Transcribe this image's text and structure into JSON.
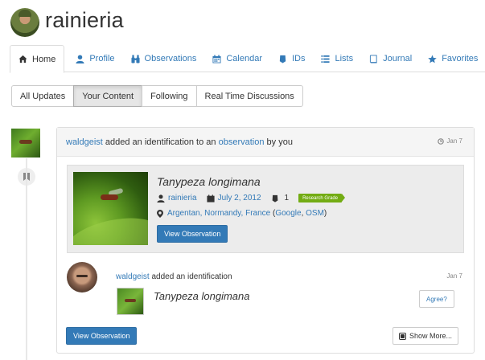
{
  "profile": {
    "username": "rainieria"
  },
  "tabs": [
    {
      "label": "Home",
      "icon": "home-icon"
    },
    {
      "label": "Profile",
      "icon": "user-icon"
    },
    {
      "label": "Observations",
      "icon": "binoculars-icon"
    },
    {
      "label": "Calendar",
      "icon": "calendar-icon"
    },
    {
      "label": "IDs",
      "icon": "tag-icon"
    },
    {
      "label": "Lists",
      "icon": "list-icon"
    },
    {
      "label": "Journal",
      "icon": "book-icon"
    },
    {
      "label": "Favorites",
      "icon": "star-icon"
    }
  ],
  "active_tab": "Home",
  "filters": [
    "All Updates",
    "Your Content",
    "Following",
    "Real Time Discussions"
  ],
  "active_filter": "Your Content",
  "update": {
    "actor": "waldgeist",
    "text_before": " added an identification to an ",
    "link_text": "observation",
    "text_after": " by you",
    "date": "Jan 7",
    "observation": {
      "taxon": "Tanypeza longimana",
      "observer": "rainieria",
      "date": "July 2, 2012",
      "id_count": "1",
      "quality": "Research Grade",
      "place": "Argentan, Normandy, France",
      "map_open": " (",
      "map_google": "Google",
      "map_sep": ", ",
      "map_osm": "OSM",
      "map_close": ")",
      "view_button": "View Observation"
    },
    "identification": {
      "actor": "waldgeist",
      "text": " added an identification",
      "date": "Jan 7",
      "taxon": "Tanypeza longimana",
      "agree_button": "Agree?"
    },
    "view_button": "View Observation",
    "show_more_button": "Show More..."
  },
  "colors": {
    "link": "#337ab7",
    "research_grade": "#73ac13",
    "primary_button": "#337ab7"
  }
}
